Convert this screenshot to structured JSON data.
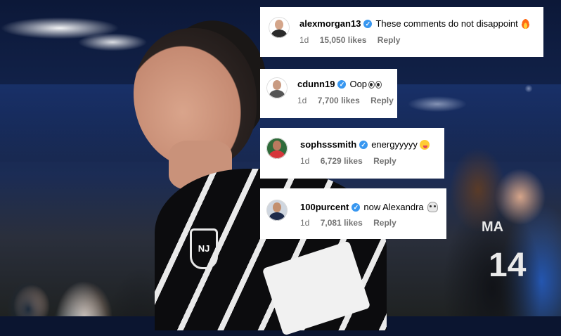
{
  "comments": [
    {
      "username": "alexmorgan13",
      "text": "These comments do not disappoint",
      "emoji": "fire-emoji",
      "age": "1d",
      "likes": "15,050 likes",
      "reply_label": "Reply"
    },
    {
      "username": "cdunn19",
      "text": "Oop",
      "emoji": "eyes-emoji",
      "age": "1d",
      "likes": "7,700 likes",
      "reply_label": "Reply"
    },
    {
      "username": "sophsssmith",
      "text": "energyyyyy",
      "emoji": "zany-face-emoji",
      "age": "1d",
      "likes": "6,729 likes",
      "reply_label": "Reply"
    },
    {
      "username": "100purcent",
      "text": "now Alexandra",
      "emoji": "skull-emoji",
      "age": "1d",
      "likes": "7,081 likes",
      "reply_label": "Reply"
    }
  ],
  "photo": {
    "jersey_badge": "NJ",
    "background_player_name": "MA",
    "background_player_number": "14"
  },
  "colors": {
    "verified_badge": "#3897f0",
    "meta_text": "#737373",
    "card_background": "#ffffff"
  }
}
